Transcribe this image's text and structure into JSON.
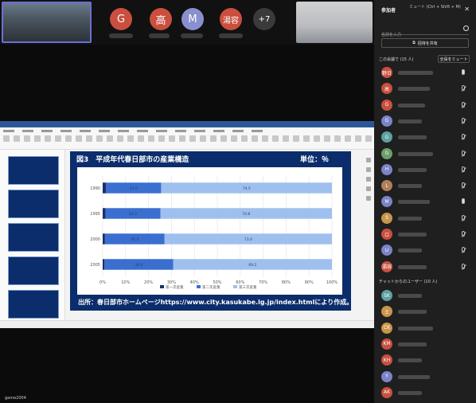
{
  "top_strip": {
    "avatars": [
      {
        "initial": "G",
        "color": "#c94f3f"
      },
      {
        "initial": "高",
        "color": "#c94f3f"
      },
      {
        "initial": "M",
        "color": "#8a8fd0"
      },
      {
        "initial": "湯容",
        "color": "#c94f3f"
      },
      {
        "initial": "+7",
        "color": "#3a3a3a"
      }
    ]
  },
  "slide": {
    "title": "図3　平成年代春日部市の産業構造",
    "unit": "単位：％",
    "source": "出所：春日部市ホームページhttps://www.city.kasukabe.lg.jp/index.htmlにより作成。"
  },
  "chart_data": {
    "type": "bar",
    "orientation": "horizontal",
    "stacked": true,
    "categories": [
      "1990",
      "1995",
      "2000",
      "2005"
    ],
    "series": [
      {
        "name": "第一次産業",
        "values": [
          1.5,
          1.2,
          1.0,
          0.8
        ],
        "color": "#1a2f6e"
      },
      {
        "name": "第二次産業",
        "values": [
          24.0,
          24.0,
          26.0,
          30.0
        ],
        "color": "#3a6fd0"
      },
      {
        "name": "第三次産業",
        "values": [
          74.5,
          74.8,
          73.0,
          69.2
        ],
        "color": "#9fc0ef"
      }
    ],
    "xlim": [
      0,
      100
    ],
    "xticks": [
      "0%",
      "10%",
      "20%",
      "30%",
      "40%",
      "50%",
      "60%",
      "70%",
      "80%",
      "90%",
      "100%"
    ],
    "legend": "bottom",
    "grid": true
  },
  "footer": {
    "meeting_label": "game2004"
  },
  "panel": {
    "title": "参加者",
    "mute_hint": "ミュート (Ctrl + Shift + M)",
    "close": "✕",
    "search_placeholder": "名前を入力",
    "share_label": "招待を共有",
    "in_meeting_label": "この会議で (15 人)",
    "mute_all_label": "全員をミュート",
    "chat_users_label": "チャットからのユーザー (10 人)",
    "in_meeting": [
      {
        "initial": "野日",
        "color": "#c94f3f",
        "mic": "on"
      },
      {
        "initial": "高",
        "color": "#c94f3f",
        "mic": "off"
      },
      {
        "initial": "G",
        "color": "#c94f3f",
        "mic": "off"
      },
      {
        "initial": "G",
        "color": "#7b83c9",
        "mic": "off"
      },
      {
        "initial": "G",
        "color": "#5fa0a0",
        "mic": "off"
      },
      {
        "initial": "G",
        "color": "#6ba06b",
        "mic": "off"
      },
      {
        "initial": "H",
        "color": "#7b83c9",
        "mic": "off"
      },
      {
        "initial": "L",
        "color": "#b0805a",
        "mic": "off"
      },
      {
        "initial": "M",
        "color": "#7b83c9",
        "mic": "on"
      },
      {
        "initial": "S",
        "color": "#c9954a",
        "mic": "off"
      },
      {
        "initial": "ロ",
        "color": "#c94f3f",
        "mic": "off"
      },
      {
        "initial": "U",
        "color": "#7b83c9",
        "mic": "off"
      },
      {
        "initial": "湯容",
        "color": "#c94f3f",
        "mic": "off"
      }
    ],
    "chat_users": [
      {
        "initial": "SK",
        "color": "#5fa0a0"
      },
      {
        "initial": "土",
        "color": "#c9954a"
      },
      {
        "initial": "CK",
        "color": "#c9954a"
      },
      {
        "initial": "KM",
        "color": "#c94f3f"
      },
      {
        "initial": "KH",
        "color": "#c94f3f"
      },
      {
        "initial": "Y",
        "color": "#7b83c9"
      },
      {
        "initial": "AK",
        "color": "#c94f3f"
      }
    ]
  }
}
